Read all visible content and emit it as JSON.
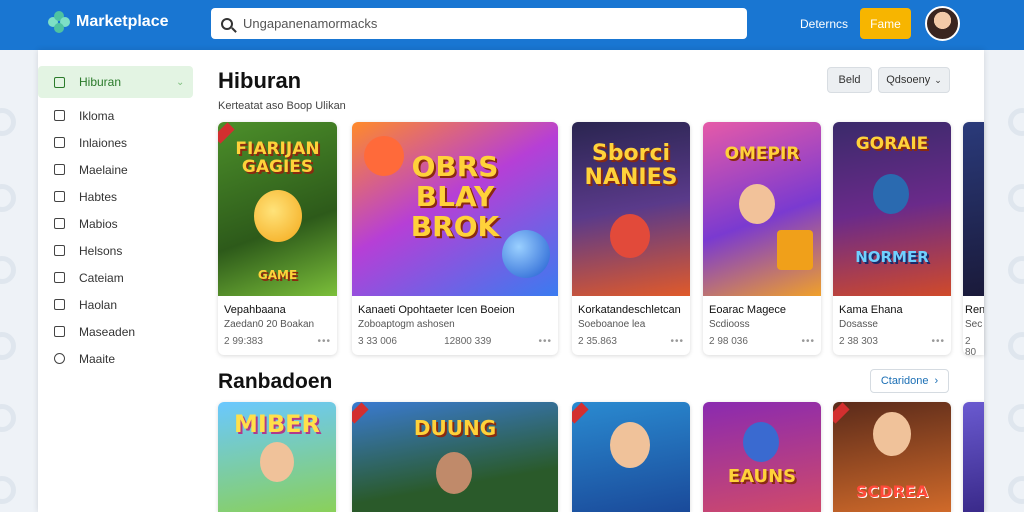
{
  "app": {
    "brand": "Marketplace"
  },
  "search": {
    "placeholder": "Ungapanenamormacks"
  },
  "topbar": {
    "link_label": "Deterncs",
    "button_label": "Fame"
  },
  "sidebar": {
    "items": [
      {
        "label": "Hiburan",
        "icon": "grid-icon",
        "active": true
      },
      {
        "label": "Ikloma",
        "icon": "bookmark-icon"
      },
      {
        "label": "Inlaiones",
        "icon": "tag-icon"
      },
      {
        "label": "Maelaine",
        "icon": "folder-icon"
      },
      {
        "label": "Habtes",
        "icon": "list-icon"
      },
      {
        "label": "Mabios",
        "icon": "mail-icon"
      },
      {
        "label": "Helsons",
        "icon": "chat-icon"
      },
      {
        "label": "Cateiam",
        "icon": "page-icon"
      },
      {
        "label": "Haolan",
        "icon": "document-icon"
      },
      {
        "label": "Maseaden",
        "icon": "note-icon"
      },
      {
        "label": "Maaite",
        "icon": "settings-icon"
      }
    ]
  },
  "main": {
    "title": "Hiburan",
    "subtitle": "Kerteatat aso Boop Ulikan",
    "btn_primary": "Beld",
    "btn_sort": "Qdsoeny",
    "section2_title": "Ranbadoen",
    "section2_more": "Ctaridone"
  },
  "cards": [
    {
      "title": "Vepahbaana",
      "sub": "Zaedan0 20 Boakan",
      "meta": "2 99:383",
      "extra": "",
      "art": "FIARIJAN GAGIES",
      "art2": "GAME"
    },
    {
      "title": "Kanaeti Opohtaeter Icen Boeion",
      "sub": "Zoboaptogm ashosen",
      "meta": "3 33 006",
      "extra": "12800 339",
      "art": "OBRS BLAY BROK",
      "art2": ""
    },
    {
      "title": "Korkatandeschletcan",
      "sub": "Soeboanoe lea",
      "meta": "2 35.863",
      "extra": "",
      "art": "Sborci NANIES",
      "art2": ""
    },
    {
      "title": "Eoarac Magece",
      "sub": "Scdiooss",
      "meta": "2 98 036",
      "extra": "",
      "art": "OMEPIR",
      "art2": ""
    },
    {
      "title": "Kama Ehana",
      "sub": "Dosasse",
      "meta": "2 38 303",
      "extra": "",
      "art": "GORAIE",
      "art2": "NORMER"
    },
    {
      "title": "Ren",
      "sub": "Sec",
      "meta": "2 80",
      "extra": "",
      "art": "",
      "art2": ""
    }
  ],
  "cards2": [
    {
      "art": "MIBER"
    },
    {
      "art": "DUUNG"
    },
    {
      "art": ""
    },
    {
      "art": "EAUNS"
    },
    {
      "art": "SCDREA"
    },
    {
      "art": ""
    }
  ],
  "colors": {
    "topbar": "#1976d2",
    "accent": "#f7b500",
    "active_bg": "#e3f4e3",
    "link": "#1b6fb5"
  }
}
